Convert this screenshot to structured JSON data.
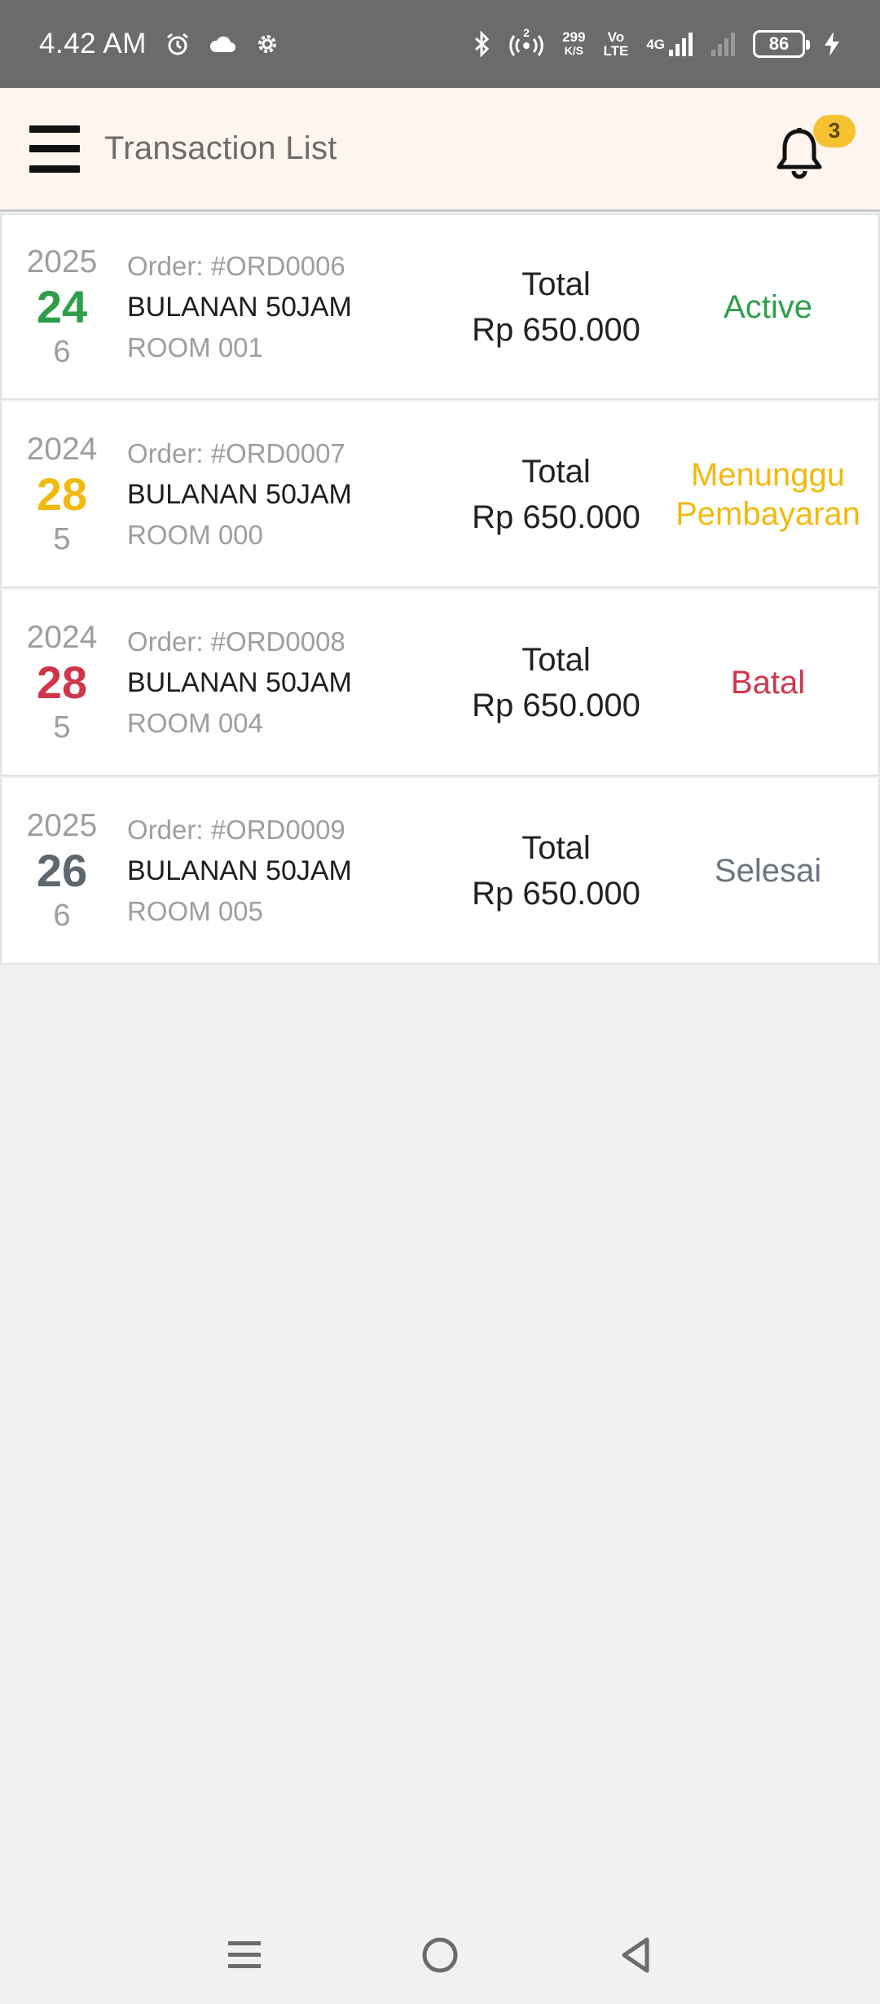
{
  "status_bar": {
    "time": "4.42 AM",
    "net_speed_value": "299",
    "net_speed_unit": "K/S",
    "volte_top": "Vo",
    "volte_bottom": "LTE",
    "network_type": "4G",
    "hotspot_count": "2",
    "battery": "86"
  },
  "app_bar": {
    "title": "Transaction List",
    "notification_count": "3"
  },
  "transactions": [
    {
      "year": "2025",
      "day": "24",
      "month": "6",
      "order": "Order: #ORD0006",
      "package": "BULANAN 50JAM",
      "room": "ROOM 001",
      "total_label": "Total",
      "total_amount": "Rp 650.000",
      "status": "Active",
      "status_color": "#2e9e4a"
    },
    {
      "year": "2024",
      "day": "28",
      "month": "5",
      "order": "Order: #ORD0007",
      "package": "BULANAN 50JAM",
      "room": "ROOM 000",
      "total_label": "Total",
      "total_amount": "Rp 650.000",
      "status_line1": "Menunggu",
      "status_line2": "Pembayaran",
      "status_color": "#f2b90f"
    },
    {
      "year": "2024",
      "day": "28",
      "month": "5",
      "order": "Order: #ORD0008",
      "package": "BULANAN 50JAM",
      "room": "ROOM 004",
      "total_label": "Total",
      "total_amount": "Rp 650.000",
      "status": "Batal",
      "status_color": "#d0364a"
    },
    {
      "year": "2025",
      "day": "26",
      "month": "6",
      "order": "Order: #ORD0009",
      "package": "BULANAN 50JAM",
      "room": "ROOM 005",
      "total_label": "Total",
      "total_amount": "Rp 650.000",
      "status": "Selesai",
      "status_color": "#6b7480"
    }
  ],
  "icons": {
    "menu": "hamburger-menu-icon",
    "bell": "bell-icon",
    "nav_recent": "recent-apps-icon",
    "nav_home": "home-icon",
    "nav_back": "back-icon"
  }
}
